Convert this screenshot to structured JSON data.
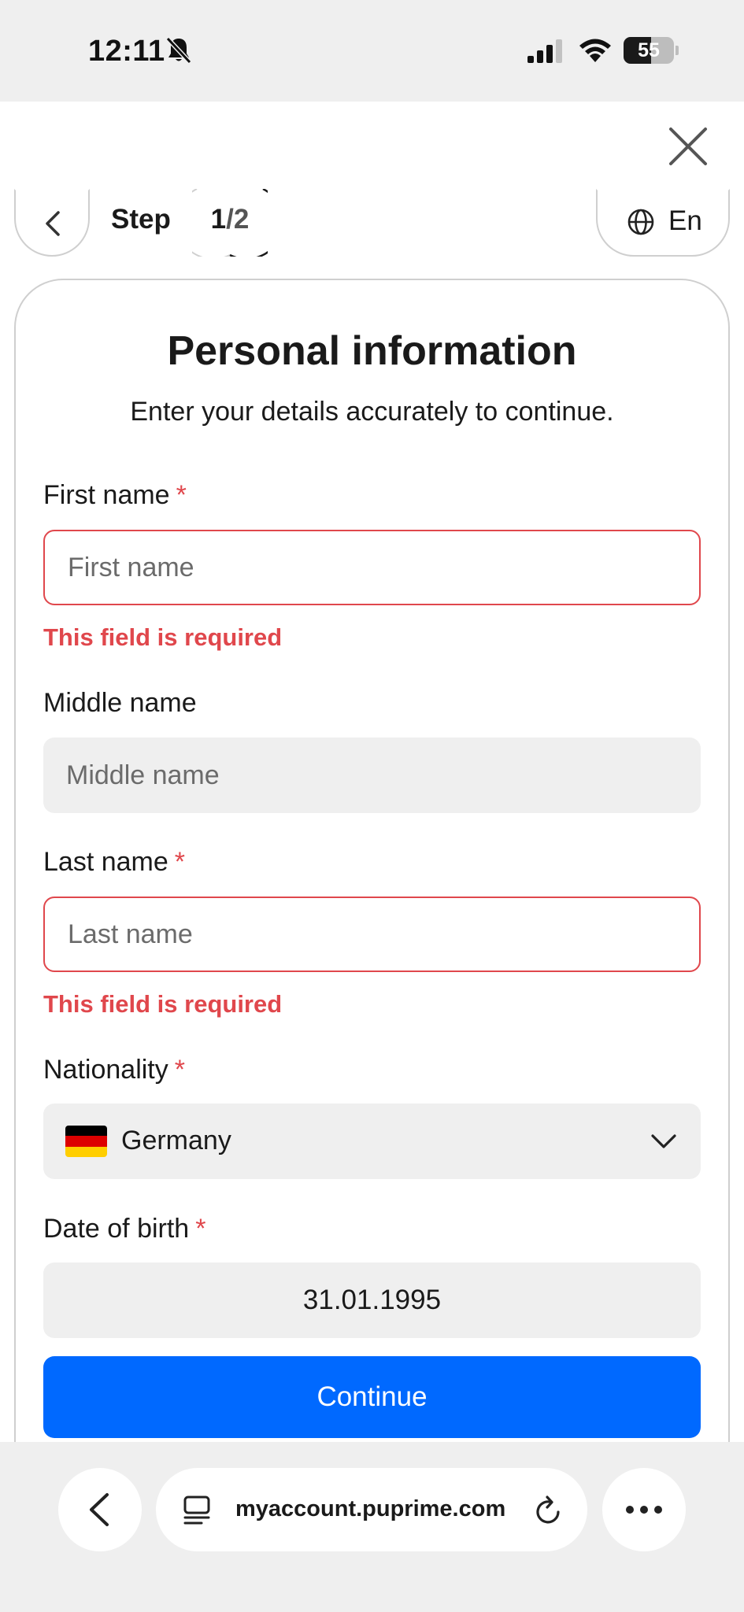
{
  "status_bar": {
    "time": "12:11",
    "battery_level": "55",
    "icons": [
      "bell-muted-icon",
      "cellular-signal-icon",
      "wifi-icon",
      "battery-icon"
    ]
  },
  "modal": {
    "close_icon": "close-icon",
    "step": {
      "label": "Step",
      "current": "1",
      "separator": "/",
      "total": "2"
    },
    "language": {
      "label": "En",
      "icon": "globe-icon"
    }
  },
  "form": {
    "title": "Personal information",
    "subtitle": "Enter your details accurately to continue.",
    "required_marker": "*",
    "first_name": {
      "label": "First name",
      "placeholder": "First name",
      "value": "",
      "error": "This field is required"
    },
    "middle_name": {
      "label": "Middle name",
      "placeholder": "Middle name",
      "value": ""
    },
    "last_name": {
      "label": "Last name",
      "placeholder": "Last name",
      "value": "",
      "error": "This field is required"
    },
    "nationality": {
      "label": "Nationality",
      "value": "Germany",
      "flag_colors": [
        "#000000",
        "#dd0000",
        "#ffce00"
      ]
    },
    "date_of_birth": {
      "label": "Date of birth",
      "value": "31.01.1995"
    },
    "continue_label": "Continue"
  },
  "browser": {
    "url": "myaccount.puprime.com",
    "icons": [
      "back-arrow-icon",
      "tab-icon",
      "reload-icon",
      "more-icon"
    ]
  },
  "colors": {
    "accent": "#0069ff",
    "error": "#e0474c",
    "field_background": "#efefef"
  }
}
